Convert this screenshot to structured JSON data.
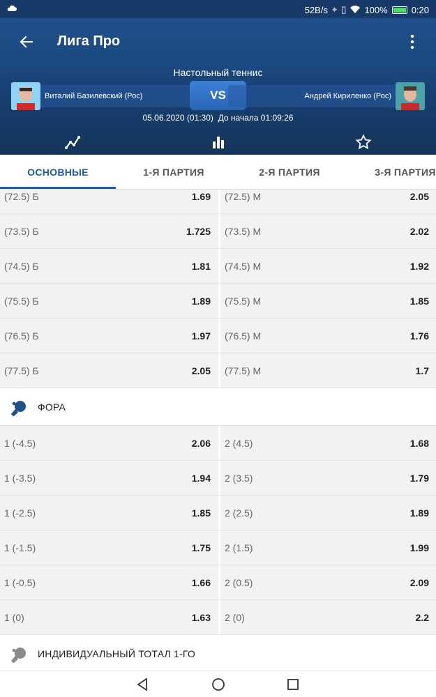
{
  "status": {
    "speed": "52B/s",
    "battery": "100%",
    "time": "0:20"
  },
  "header": {
    "title": "Лига Про",
    "sport": "Настольный теннис",
    "player1": "Виталий Базилевский (Рос)",
    "player2": "Андрей Кириленко (Рос)",
    "vs": "VS",
    "date": "05.06.2020 (01:30)",
    "countdown": "До начала 01:09:26"
  },
  "tabs": [
    "ОСНОВНЫЕ",
    "1-Я ПАРТИЯ",
    "2-Я ПАРТИЯ",
    "3-Я ПАРТИЯ"
  ],
  "total_rows": [
    {
      "l_name": "(72.5) Б",
      "l_val": "1.69",
      "r_name": "(72.5) М",
      "r_val": "2.05"
    },
    {
      "l_name": "(73.5) Б",
      "l_val": "1.725",
      "r_name": "(73.5) М",
      "r_val": "2.02"
    },
    {
      "l_name": "(74.5) Б",
      "l_val": "1.81",
      "r_name": "(74.5) М",
      "r_val": "1.92"
    },
    {
      "l_name": "(75.5) Б",
      "l_val": "1.89",
      "r_name": "(75.5) М",
      "r_val": "1.85"
    },
    {
      "l_name": "(76.5) Б",
      "l_val": "1.97",
      "r_name": "(76.5) М",
      "r_val": "1.76"
    },
    {
      "l_name": "(77.5) Б",
      "l_val": "2.05",
      "r_name": "(77.5) М",
      "r_val": "1.7"
    }
  ],
  "section_fora": "ФОРА",
  "fora_rows": [
    {
      "l_name": "1 (-4.5)",
      "l_val": "2.06",
      "r_name": "2 (4.5)",
      "r_val": "1.68"
    },
    {
      "l_name": "1 (-3.5)",
      "l_val": "1.94",
      "r_name": "2 (3.5)",
      "r_val": "1.79"
    },
    {
      "l_name": "1 (-2.5)",
      "l_val": "1.85",
      "r_name": "2 (2.5)",
      "r_val": "1.89"
    },
    {
      "l_name": "1 (-1.5)",
      "l_val": "1.75",
      "r_name": "2 (1.5)",
      "r_val": "1.99"
    },
    {
      "l_name": "1 (-0.5)",
      "l_val": "1.66",
      "r_name": "2 (0.5)",
      "r_val": "2.09"
    },
    {
      "l_name": "1 (0)",
      "l_val": "1.63",
      "r_name": "2 (0)",
      "r_val": "2.2"
    }
  ],
  "section_individual": "ИНДИВИДУАЛЬНЫЙ ТОТАЛ 1-ГО",
  "colors": {
    "header": "#1c4a82",
    "accent": "#1f5aa6",
    "row_bg": "#f2f2f2"
  },
  "icons": [
    "back-icon",
    "more-icon",
    "stats-line-icon",
    "bar-chart-icon",
    "star-icon",
    "table-tennis-icon",
    "nav-back-icon",
    "nav-home-icon",
    "nav-recents-icon"
  ]
}
